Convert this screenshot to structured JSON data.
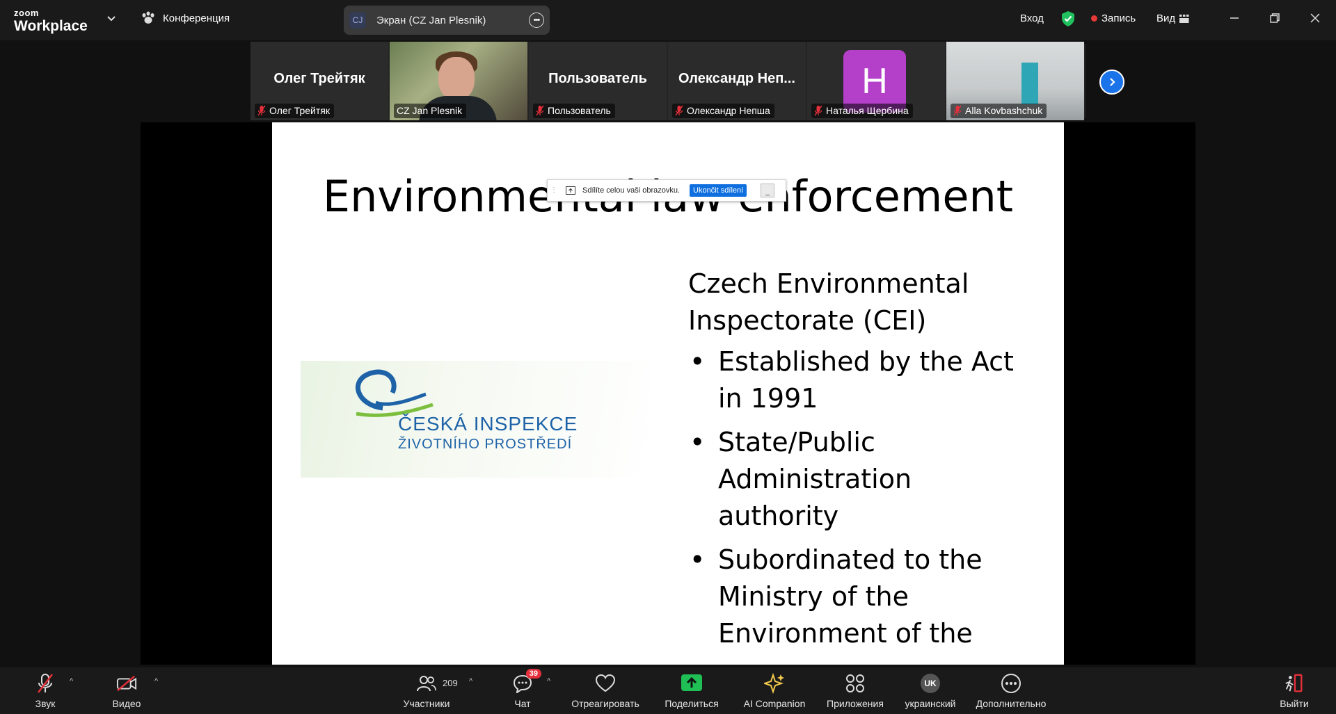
{
  "app": {
    "brand_line1": "zoom",
    "brand_line2": "Workplace",
    "meeting_label": "Конференция",
    "screen_pill_avatar": "CJ",
    "screen_pill_text": "Экран (CZ Jan Plesnik)",
    "sign_in": "Вход",
    "record": "Запись",
    "view": "Вид",
    "shield_color": "#20c15e"
  },
  "participants": [
    {
      "big_name": "Олег Трейтяк",
      "tag": "Олег Трейтяк",
      "muted": true,
      "type": "name"
    },
    {
      "big_name": "",
      "tag": "CZ Jan Plesnik",
      "muted": false,
      "type": "video",
      "active_speaker": true
    },
    {
      "big_name": "Пользователь",
      "tag": "Пользователь",
      "muted": true,
      "type": "name"
    },
    {
      "big_name": "Олександр  Неп...",
      "tag": "Олександр Непша",
      "muted": true,
      "type": "name"
    },
    {
      "big_name": "",
      "tag": "Наталья Щербина",
      "muted": true,
      "type": "avatar",
      "avatar_letter": "H",
      "avatar_color": "#b43fc9"
    },
    {
      "big_name": "",
      "tag": "Alla Kovbashchuk",
      "muted": true,
      "type": "video"
    }
  ],
  "slide": {
    "title": "Environmental law enforcement",
    "logo_line1": "ČESKÁ INSPEKCE",
    "logo_line2": "ŽIVOTNÍHO PROSTŘEDÍ",
    "heading_line1": "Czech Environmental",
    "heading_line2": "Inspectorate (CEI)",
    "bullets": [
      [
        "Established by the Act",
        "in 1991"
      ],
      [
        "State/Public",
        "Administration",
        "authority"
      ],
      [
        "Subordinated to the",
        "Ministry of the",
        "Environment of the"
      ]
    ]
  },
  "share_toolbar": {
    "text": "Sdílíte celou vaši obrazovku.",
    "stop_button": "Ukončit sdílení"
  },
  "toolbar": {
    "audio": "Звук",
    "video": "Видео",
    "participants": "Участники",
    "participants_count": "209",
    "chat": "Чат",
    "chat_badge": "39",
    "react": "Отреагировать",
    "share": "Поделиться",
    "ai": "AI Companion",
    "apps": "Приложения",
    "language_code": "UK",
    "language": "украинский",
    "more": "Дополнительно",
    "leave": "Выйти",
    "share_color": "#1fbf55",
    "ai_color": "#f2c94c",
    "leave_color": "#e5303b"
  }
}
